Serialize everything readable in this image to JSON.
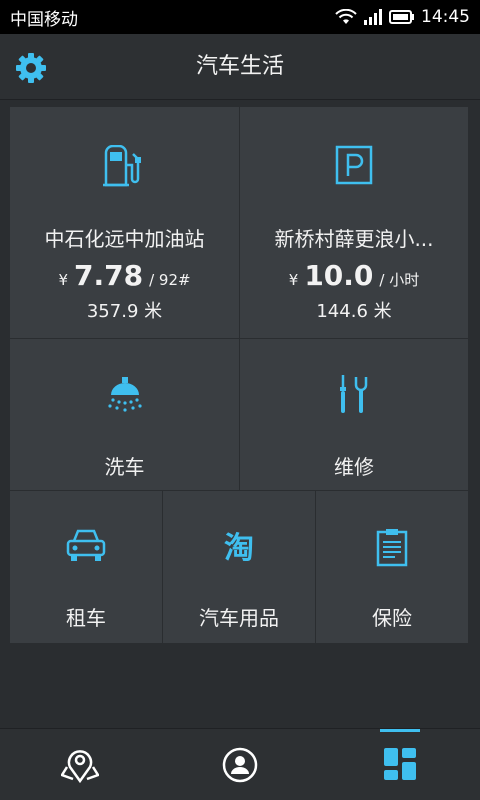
{
  "status_bar": {
    "carrier": "中国移动",
    "time": "14:45"
  },
  "app_bar": {
    "title": "汽车生活",
    "settings_icon": "gear-icon"
  },
  "accent_color": "#3fbfef",
  "gas_station": {
    "name": "中石化远中加油站",
    "currency": "¥",
    "price": "7.78",
    "unit": "/ 92#",
    "distance": "357.9 米",
    "icon": "fuel-pump-icon"
  },
  "parking": {
    "name": "新桥村薛更浪小...",
    "currency": "¥",
    "price": "10.0",
    "unit": "/ 小时",
    "distance": "144.6 米",
    "icon": "parking-icon"
  },
  "services": {
    "car_wash": {
      "label": "洗车",
      "icon": "shower-icon"
    },
    "repair": {
      "label": "维修",
      "icon": "tools-icon"
    },
    "rental": {
      "label": "租车",
      "icon": "car-icon"
    },
    "supplies": {
      "label": "汽车用品",
      "icon": "taobao-icon"
    },
    "insurance": {
      "label": "保险",
      "icon": "document-icon"
    }
  },
  "bottom_nav": [
    {
      "name": "map",
      "icon": "location-icon"
    },
    {
      "name": "profile",
      "icon": "user-icon"
    },
    {
      "name": "apps",
      "icon": "grid-icon",
      "active": true
    }
  ]
}
